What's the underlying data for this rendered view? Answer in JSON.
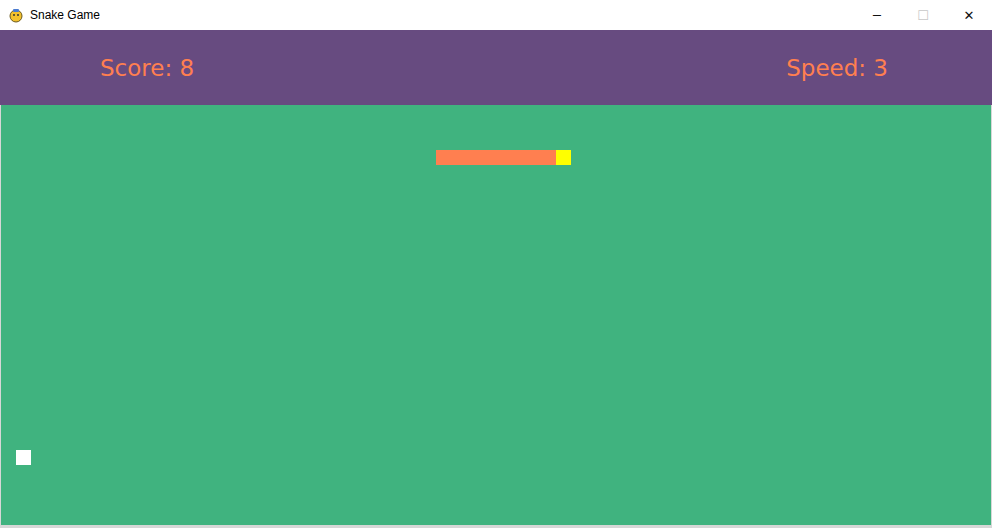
{
  "window": {
    "title": "Snake Game",
    "controls": [
      {
        "label": "─",
        "disabled": false
      },
      {
        "label": "☐",
        "disabled": true
      },
      {
        "label": "✕",
        "disabled": false
      }
    ]
  },
  "hud": {
    "score": "Score: 8",
    "speed": "Speed: 3"
  },
  "snake": [
    {
      "col": 29,
      "row": 3,
      "kind": "body"
    },
    {
      "col": 30,
      "row": 3,
      "kind": "body"
    },
    {
      "col": 31,
      "row": 3,
      "kind": "body"
    },
    {
      "col": 32,
      "row": 3,
      "kind": "body"
    },
    {
      "col": 33,
      "row": 3,
      "kind": "body"
    },
    {
      "col": 34,
      "row": 3,
      "kind": "body"
    },
    {
      "col": 35,
      "row": 3,
      "kind": "body"
    },
    {
      "col": 36,
      "row": 3,
      "kind": "body"
    },
    {
      "col": 37,
      "row": 3,
      "kind": "head"
    }
  ],
  "food": {
    "col": 1,
    "row": 23
  }
}
